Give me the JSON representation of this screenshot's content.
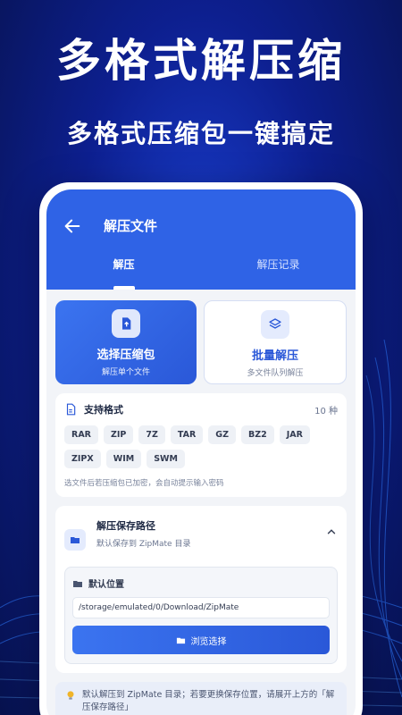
{
  "promo": {
    "headline": "多格式解压缩",
    "subhead": "多格式压缩包一键搞定"
  },
  "appbar": {
    "title": "解压文件",
    "tabs": [
      {
        "label": "解压",
        "active": true
      },
      {
        "label": "解压记录",
        "active": false
      }
    ]
  },
  "cards": {
    "select": {
      "title": "选择压缩包",
      "subtitle": "解压单个文件"
    },
    "batch": {
      "title": "批量解压",
      "subtitle": "多文件队列解压"
    }
  },
  "formats": {
    "title": "支持格式",
    "count": "10 种",
    "items": [
      "RAR",
      "ZIP",
      "7Z",
      "TAR",
      "GZ",
      "BZ2",
      "JAR",
      "ZIPX",
      "WIM",
      "SWM"
    ],
    "note": "选文件后若压缩包已加密，会自动提示输入密码"
  },
  "save_path": {
    "title": "解压保存路径",
    "subtitle": "默认保存到 ZipMate 目录",
    "default_label": "默认位置",
    "path_value": "/storage/emulated/0/Download/ZipMate",
    "browse_label": "浏览选择"
  },
  "tip": {
    "text": "默认解压到 ZipMate 目录；若要更换保存位置，请展开上方的「解压保存路径」"
  },
  "colors": {
    "accent": "#2f63e6",
    "background": "#0d1f8f"
  }
}
